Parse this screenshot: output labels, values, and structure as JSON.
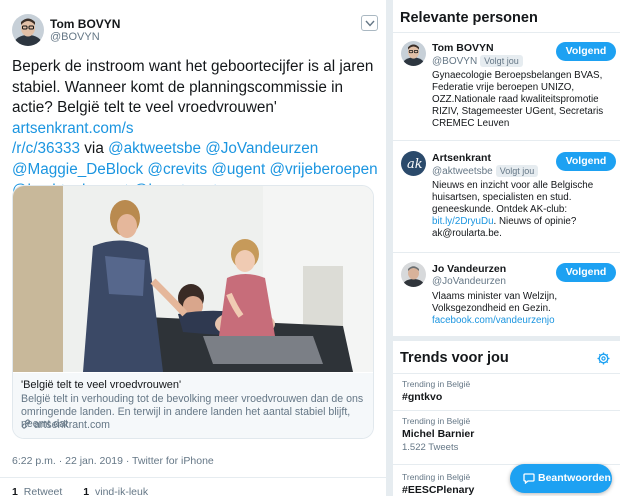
{
  "tweet": {
    "author_name": "Tom BOVYN",
    "author_handle": "@BOVYN",
    "text_plain_1": "Beperk de instroom want het geboortecijfer is al jaren stabiel. Wanneer komt de planningscommissie in actie? België telt te veel vroedvrouwen' ",
    "link_1": "artsenkrant.com/s\n/r/c/36333",
    "text_plain_2": " via ",
    "mentions": "@aktweetsbe @JoVandeurzen\n@Maggie_DeBlock  @crevits @ugent @vrijeberoepen\n@hashtaghogent @bvastweets",
    "card": {
      "title": "'België telt te veel vroedvrouwen'",
      "description": "België telt in verhouding tot de bevolking meer vroedvrouwen dan de ons omringende landen. En terwijl in andere landen het aantal stabiel blijft, neemt dat",
      "domain": "artsenkrant.com"
    },
    "meta": "6:22 p.m. · 22 jan. 2019 · Twitter for iPhone",
    "retweet_count": "1",
    "retweet_label": "Retweet",
    "like_count": "1",
    "like_label": "vind-ik-leuk"
  },
  "relevant": {
    "heading": "Relevante personen",
    "follows_badge": "Volgt jou",
    "follow_label": "Volgend",
    "people": [
      {
        "name": "Tom BOVYN",
        "handle": "@BOVYN",
        "follows_you": true,
        "bio": "Gynaecologie Beroepsbelangen BVAS, Federatie vrije beroepen UNIZO, OZZ.Nationale raad kwaliteitspromotie RIZIV, Stagemeester UGent, Secretaris CREMEC Leuven"
      },
      {
        "name": "Artsenkrant",
        "handle": "@aktweetsbe",
        "follows_you": true,
        "bio": "Nieuws en inzicht voor alle Belgische huisartsen, specialisten en stud. geneeskunde. Ontdek AK-club: ",
        "bio_link": "bit.ly/2DryuDu",
        "bio_rest": ". Nieuws of opinie? ak@roularta.be."
      },
      {
        "name": "Jo Vandeurzen",
        "handle": "@JoVandeurzen",
        "follows_you": false,
        "bio": "Vlaams minister van Welzijn, Volksgezondheid en Gezin.",
        "bio_link": "facebook.com/vandeurzenjo"
      }
    ]
  },
  "trends": {
    "heading": "Trends voor jou",
    "items": [
      {
        "context": "Trending in België",
        "name": "#gntkvo",
        "count": ""
      },
      {
        "context": "Trending in België",
        "name": "Michel Barnier",
        "count": "1.522 Tweets"
      },
      {
        "context": "Trending in België",
        "name": "#EESCPlenary",
        "count": ""
      }
    ]
  },
  "reply_button_label": "Beantwoorden",
  "icons": {
    "caret": "chevron-down-icon",
    "link": "link-icon",
    "settings": "gear-icon",
    "reply": "compose-icon"
  },
  "colors": {
    "accent": "#1da1f2",
    "link": "#1b95e0",
    "secondary_text": "#657786",
    "background": "#e6ecf0"
  }
}
